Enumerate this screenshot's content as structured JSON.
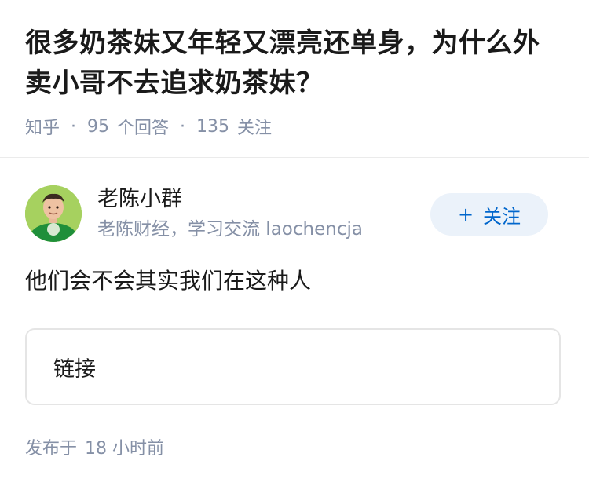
{
  "question": {
    "title": "很多奶茶妹又年轻又漂亮还单身，为什么外卖小哥不去追求奶茶妹？",
    "source": "知乎",
    "separator": "·",
    "answers_count": "95",
    "answers_label": "个回答",
    "followers_count": "135",
    "followers_label": "关注"
  },
  "author": {
    "name": "老陈小群",
    "headline": "老陈财经，学习交流 laochencja",
    "avatar_icon": "avatar-person-icon",
    "follow_button": {
      "plus": "+",
      "label": "关注"
    }
  },
  "answer": {
    "text": "他们会不会其实我们在这种人",
    "link_card": {
      "label": "链接"
    },
    "publish": {
      "prefix": "发布于",
      "time": "18 小时前"
    }
  },
  "colors": {
    "muted": "#8590a6",
    "accent": "#0066cc",
    "follow_bg": "#ebf2fa",
    "border": "#e5e5e5"
  }
}
